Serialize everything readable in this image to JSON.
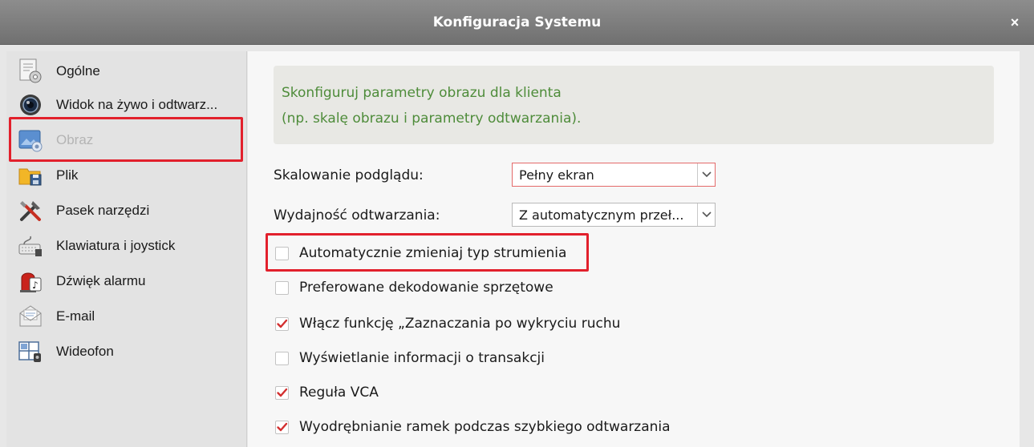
{
  "window": {
    "title": "Konfiguracja Systemu",
    "close_glyph": "×"
  },
  "sidebar": {
    "items": [
      {
        "label": "Ogólne",
        "icon": "settings-document-icon",
        "selected": false
      },
      {
        "label": "Widok na żywo i odtwarz...",
        "icon": "camera-lens-icon",
        "selected": false
      },
      {
        "label": "Obraz",
        "icon": "image-icon",
        "selected": true
      },
      {
        "label": "Plik",
        "icon": "folder-save-icon",
        "selected": false
      },
      {
        "label": "Pasek narzędzi",
        "icon": "tools-icon",
        "selected": false
      },
      {
        "label": "Klawiatura i joystick",
        "icon": "keyboard-joystick-icon",
        "selected": false
      },
      {
        "label": "Dźwięk alarmu",
        "icon": "alarm-sound-icon",
        "selected": false
      },
      {
        "label": "E-mail",
        "icon": "email-icon",
        "selected": false
      },
      {
        "label": "Wideofon",
        "icon": "video-intercom-icon",
        "selected": false
      }
    ]
  },
  "main": {
    "info_line1": "Skonfiguruj parametry obrazu dla klienta",
    "info_line2": "(np. skalę obrazu i parametry odtwarzania).",
    "preview_scaling": {
      "label": "Skalowanie podglądu:",
      "value": "Pełny ekran"
    },
    "playback_performance": {
      "label": "Wydajność odtwarzania:",
      "value": "Z automatycznym przeł..."
    },
    "checkboxes": [
      {
        "label": "Automatycznie zmieniaj typ strumienia",
        "checked": false
      },
      {
        "label": "Preferowane dekodowanie sprzętowe",
        "checked": false
      },
      {
        "label": "Włącz funkcję „Zaznaczania po wykryciu ruchu",
        "checked": true
      },
      {
        "label": "Wyświetlanie informacji o transakcji",
        "checked": false
      },
      {
        "label": "Reguła VCA",
        "checked": true
      },
      {
        "label": "Wyodrębnianie ramek podczas szybkiego odtwarzania",
        "checked": true
      }
    ]
  },
  "colors": {
    "highlight": "#e2202c",
    "info_text": "#4e8c3a",
    "check": "#d32f2f"
  }
}
